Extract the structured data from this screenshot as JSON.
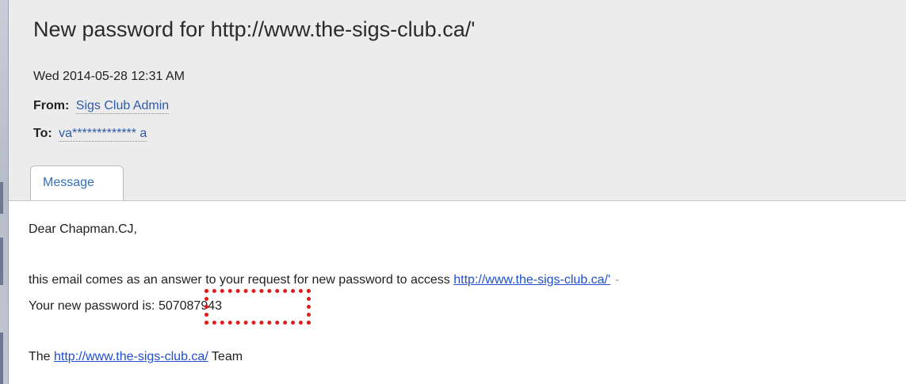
{
  "email": {
    "subject": "New password for http://www.the-sigs-club.ca/'",
    "date": "Wed 2014-05-28 12:31 AM",
    "from_label": "From:",
    "from_value": "Sigs Club Admin",
    "to_label": "To:",
    "to_value": "va************* a"
  },
  "tabs": [
    {
      "label": "Message"
    }
  ],
  "body": {
    "greeting": "Dear Chapman.CJ,",
    "line1_text": "this email comes as an answer to your request for new password to access ",
    "line1_link": "http://www.the-sigs-club.ca/'",
    "line1_trailing": "-",
    "line2_text": "Your new password is: ",
    "password": "507087943",
    "line3_prefix": "The ",
    "line3_link": "http://www.the-sigs-club.ca/",
    "line3_suffix": " Team"
  },
  "colors": {
    "highlight_box": "#e01b1b",
    "link": "#1f4fcf",
    "header_bg": "#ececec",
    "tab_label": "#2e6fc0"
  }
}
